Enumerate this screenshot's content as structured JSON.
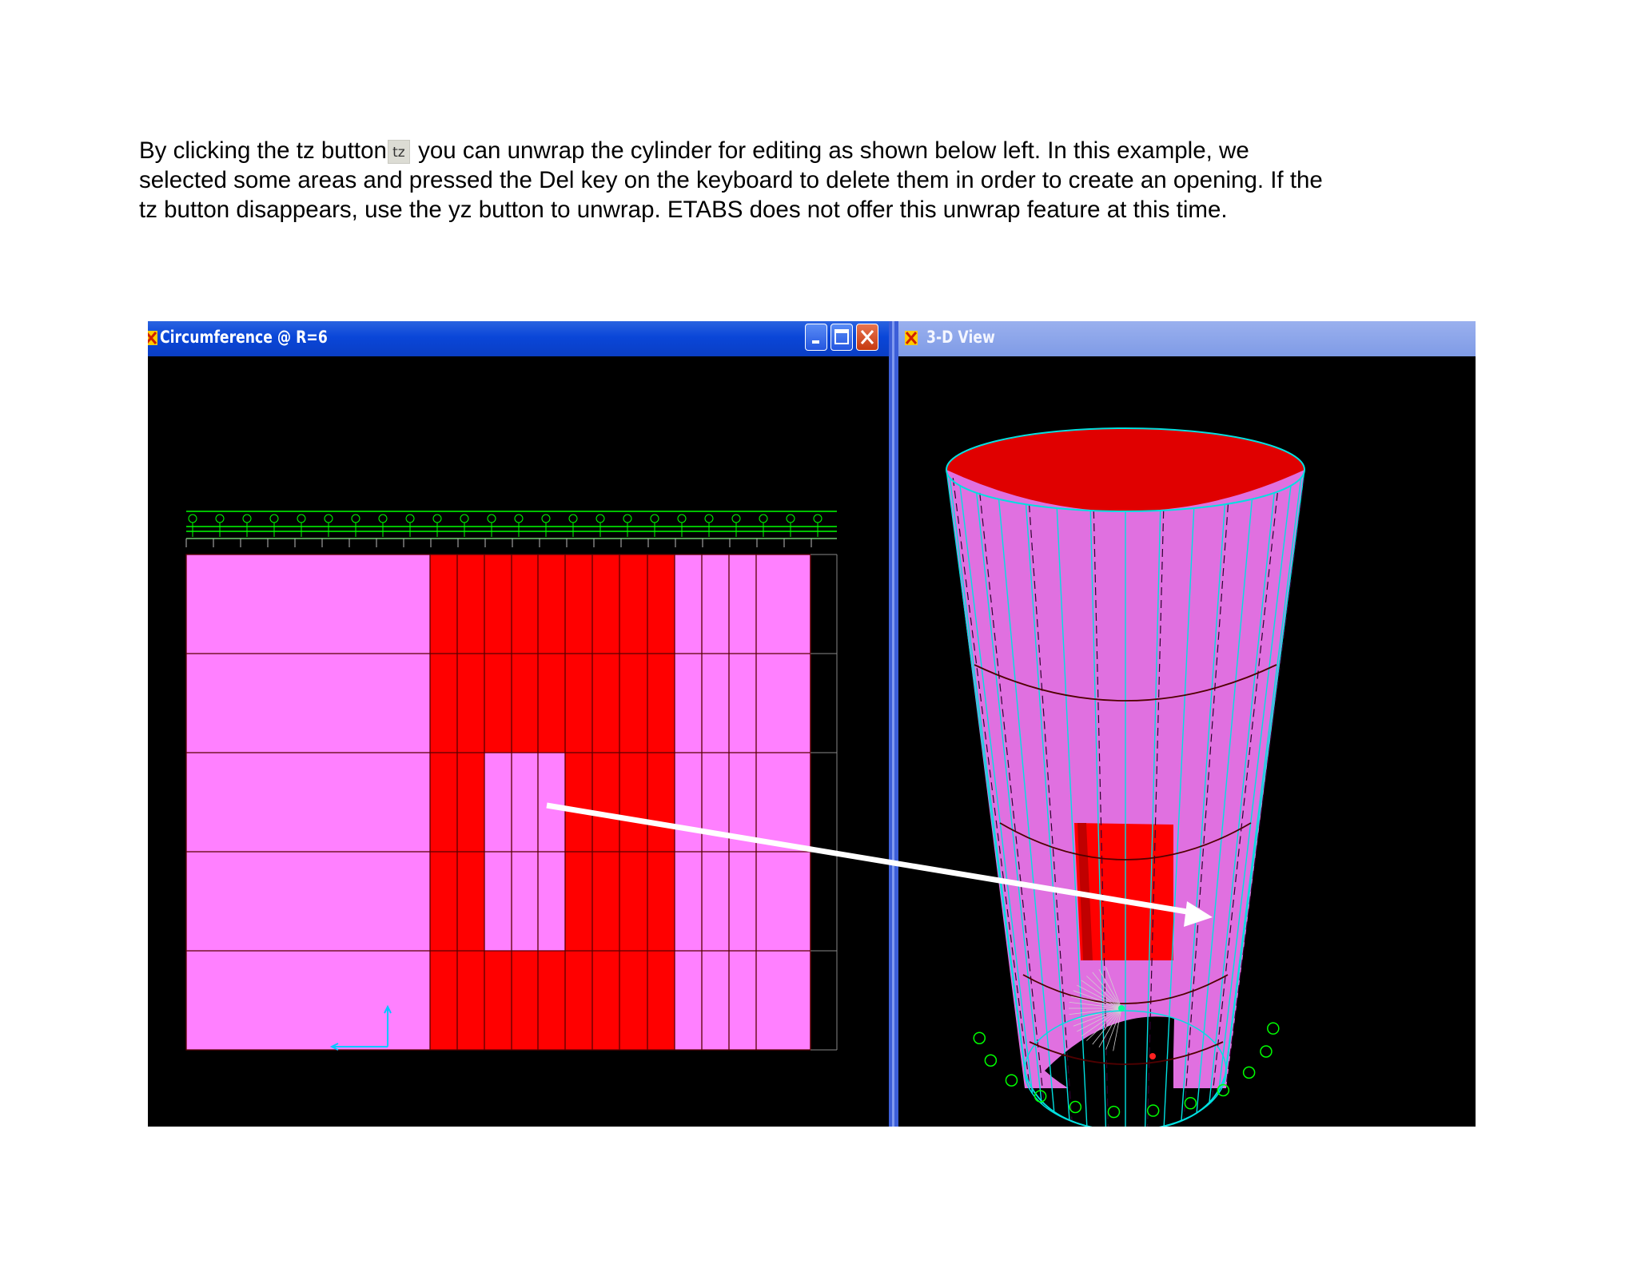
{
  "paragraph": {
    "line1_before": "By clicking the tz button",
    "button_label": "tz",
    "line1_after": " you can unwrap the cylinder for editing as shown below left. In this example, we",
    "line2": "selected some areas and pressed the Del key on the keyboard to delete them in order to create an opening. If the",
    "line3": "tz button disappears, use the yz button to unwrap. ETABS does not offer this unwrap feature at this time."
  },
  "left_window": {
    "title": "Circumference @ R=6"
  },
  "right_window": {
    "title": "3-D View"
  },
  "colors": {
    "desktop_bg": "#000000",
    "shell_pink": "#ff80ff",
    "shell_red": "#ff0000",
    "mesh_outline": "#00e5e5",
    "grid_bubble": "#00ff00",
    "arrow": "#ffffff"
  },
  "icons": [
    "etabs-app-icon",
    "minimize-icon",
    "maximize-icon",
    "close-icon",
    "axis-triad-icon",
    "grid-bubble-icon"
  ]
}
